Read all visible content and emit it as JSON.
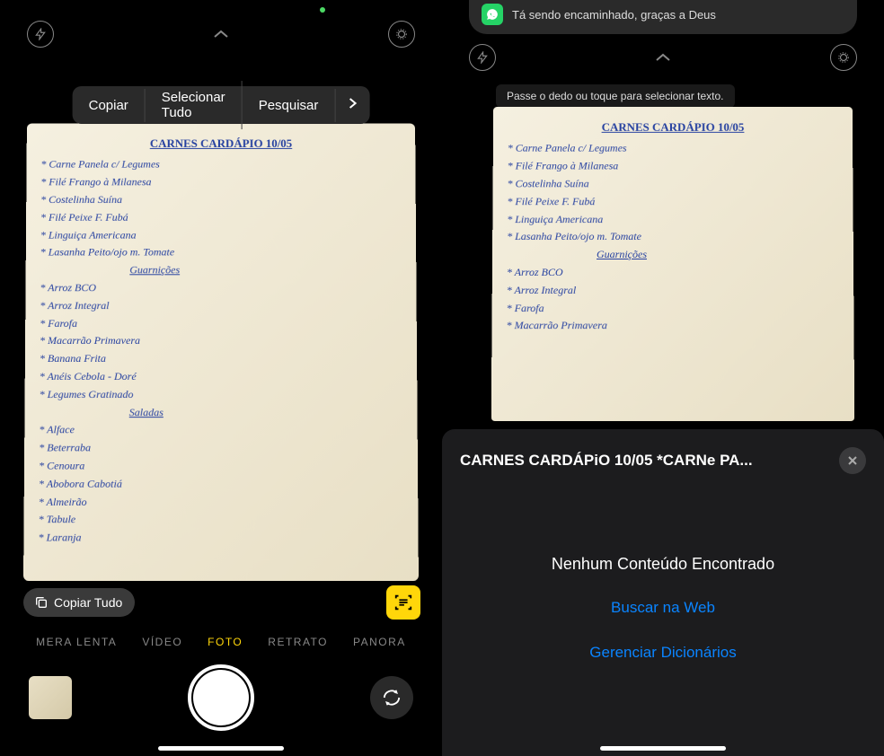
{
  "left": {
    "contextMenu": {
      "copy": "Copiar",
      "selectAll": "Selecionar Tudo",
      "search": "Pesquisar"
    },
    "copyAllBtn": "Copiar Tudo",
    "modes": {
      "slowmo": "MERA LENTA",
      "video": "VÍDEO",
      "photo": "FOTO",
      "portrait": "RETRATO",
      "pano": "PANORA"
    },
    "paper": {
      "title": "CARNES CARDÁPIO 10/05",
      "lines": [
        "* Carne Panela c/ Legumes",
        "* Filé Frango à Milanesa",
        "* Costelinha Suína",
        "* Filé Peixe F. Fubá",
        "* Linguiça Americana",
        "* Lasanha Peito/ojo m. Tomate"
      ],
      "section1": "Guarnições",
      "sides": [
        "* Arroz BCO",
        "* Arroz Integral",
        "* Farofa",
        "* Macarrão Primavera",
        "* Banana Frita",
        "* Anéis Cebola - Doré",
        "* Legumes Gratinado"
      ],
      "section2": "Saladas",
      "salads": [
        "* Alface",
        "* Beterraba",
        "* Cenoura",
        "* Abobora Cabotiá",
        "* Almeirão",
        "* Tabule",
        "* Laranja"
      ]
    }
  },
  "right": {
    "whatsapp": "Tá sendo encaminhado, graças a Deus",
    "tooltip": "Passe o dedo ou toque para selecionar texto.",
    "lookup": {
      "title": "CARNES CARDÁPiO 10/05 *CARNe PA...",
      "noContent": "Nenhum Conteúdo Encontrado",
      "searchWeb": "Buscar na Web",
      "manageDict": "Gerenciar Dicionários"
    },
    "paper": {
      "title": "CARNES CARDÁPIO 10/05",
      "lines": [
        "* Carne Panela c/ Legumes",
        "* Filé Frango à Milanesa",
        "* Costelinha Suína",
        "* Filé Peixe F. Fubá",
        "* Linguiça Americana",
        "* Lasanha Peito/ojo m. Tomate"
      ],
      "section1": "Guarnições",
      "sides": [
        "* Arroz BCO",
        "* Arroz Integral",
        "* Farofa",
        "* Macarrão Primavera"
      ]
    }
  }
}
